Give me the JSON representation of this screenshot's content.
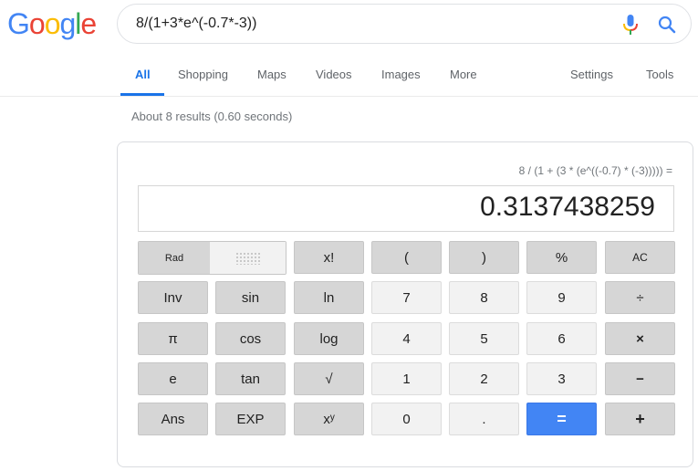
{
  "logo": {
    "letters": [
      "G",
      "o",
      "o",
      "g",
      "l",
      "e"
    ],
    "colors": [
      "#4285f4",
      "#ea4335",
      "#fbbc05",
      "#4285f4",
      "#34a853",
      "#ea4335"
    ]
  },
  "search": {
    "query": "8/(1+3*e^(-0.7*-3))",
    "mic_icon": "microphone-icon",
    "search_icon": "magnifier-icon"
  },
  "tabs": {
    "items": [
      {
        "label": "All",
        "active": true
      },
      {
        "label": "Shopping"
      },
      {
        "label": "Maps"
      },
      {
        "label": "Videos"
      },
      {
        "label": "Images"
      },
      {
        "label": "More"
      }
    ],
    "settings": "Settings",
    "tools": "Tools",
    "accent": "#1a73e8"
  },
  "stats": "About 8 results (0.60 seconds)",
  "calculator": {
    "expression": "8 / (1 + (3 * (e^((-0.7) * (-3))))) =",
    "result": "0.3137438259",
    "angle_mode": {
      "selected": "Rad",
      "other": ""
    },
    "rows": [
      [
        "x!",
        "(",
        ")",
        "%",
        "AC"
      ],
      [
        "Inv",
        "sin",
        "ln",
        "7",
        "8",
        "9",
        "÷"
      ],
      [
        "π",
        "cos",
        "log",
        "4",
        "5",
        "6",
        "×"
      ],
      [
        "e",
        "tan",
        "√",
        "1",
        "2",
        "3",
        "−"
      ],
      [
        "Ans",
        "EXP",
        "xʸ",
        "0",
        ".",
        "=",
        "+"
      ]
    ],
    "equals_color": "#4285f4"
  }
}
